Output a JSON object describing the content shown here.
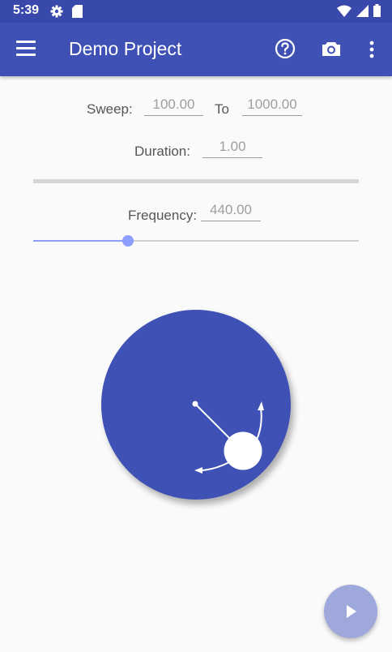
{
  "status_bar": {
    "time": "5:39",
    "icons": [
      "gear-icon",
      "sd-card-icon",
      "wifi-icon",
      "signal-icon",
      "battery-icon"
    ]
  },
  "app_bar": {
    "title": "Demo Project",
    "actions": [
      "menu-icon",
      "help-icon",
      "camera-icon",
      "more-vert-icon"
    ]
  },
  "sweep": {
    "label": "Sweep:",
    "from_value": "100.00",
    "to_label": "To",
    "to_value": "1000.00"
  },
  "duration": {
    "label": "Duration:",
    "value": "1.00"
  },
  "frequency": {
    "label": "Frequency:",
    "value": "440.00",
    "slider_fraction": 0.29
  },
  "colors": {
    "primary": "#3f51b5",
    "primary_dark": "#3949ab",
    "accent_light": "#8c9eff",
    "fab": "#9fa8da"
  },
  "fab": {
    "icon": "play-icon"
  }
}
